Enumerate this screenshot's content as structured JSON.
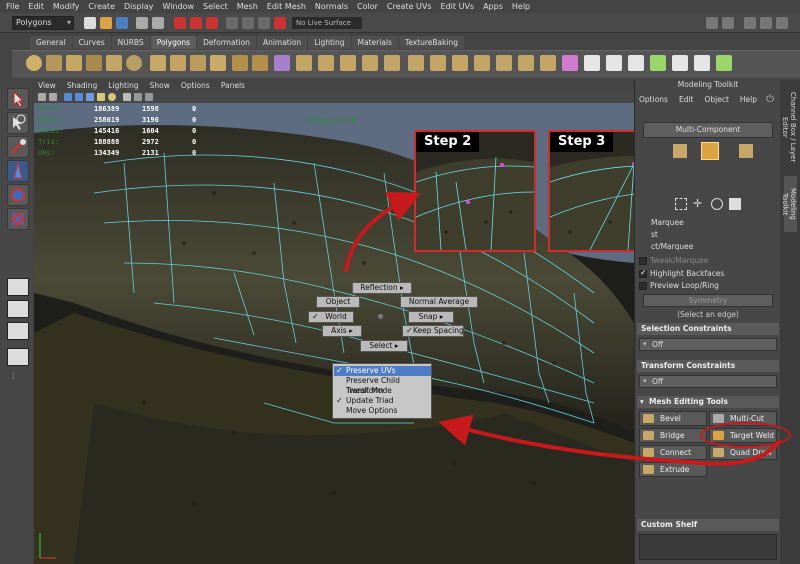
{
  "menubar": [
    "File",
    "Edit",
    "Modify",
    "Create",
    "Display",
    "Window",
    "Select",
    "Mesh",
    "Edit Mesh",
    "Normals",
    "Color",
    "Create UVs",
    "Edit UVs",
    "Apps",
    "Help"
  ],
  "status": {
    "mode": "Polygons",
    "live_surface": "No Live Surface"
  },
  "shelf_tabs": [
    {
      "label": "General",
      "active": false
    },
    {
      "label": "Curves",
      "active": false
    },
    {
      "label": "NURBS",
      "active": false
    },
    {
      "label": "Polygons",
      "active": true
    },
    {
      "label": "Deformation",
      "active": false
    },
    {
      "label": "Animation",
      "active": false
    },
    {
      "label": "Lighting",
      "active": false
    },
    {
      "label": "Materials",
      "active": false
    },
    {
      "label": "TextureBaking",
      "active": false
    }
  ],
  "viewport": {
    "menu": [
      "View",
      "Shading",
      "Lighting",
      "Show",
      "Options",
      "Panels"
    ],
    "hud": [
      {
        "label": "Verts:",
        "c1": "186389",
        "c2": "1598",
        "c3": "0"
      },
      {
        "label": "Edges:",
        "c1": "258019",
        "c2": "3196",
        "c3": "0"
      },
      {
        "label": "Faces:",
        "c1": "145416",
        "c2": "1604",
        "c3": "0"
      },
      {
        "label": "Tris:",
        "c1": "188888",
        "c2": "2972",
        "c3": "0"
      },
      {
        "label": "UVs:",
        "c1": "134349",
        "c2": "2131",
        "c3": "0"
      }
    ],
    "hud_title": "Viewport 2.0",
    "step2": "Step 2",
    "step3": "Step 3"
  },
  "marking_menu": {
    "reflection": "Reflection",
    "object": "Object",
    "normal_average": "Normal Average",
    "world": "World",
    "snap": "Snap",
    "axis": "Axis",
    "keep_spacing": "Keep Spacing",
    "select": "Select"
  },
  "options_menu": {
    "items": [
      {
        "label": "Preserve UVs",
        "checked": true,
        "active": true
      },
      {
        "label": "Preserve Child Transform",
        "checked": false,
        "active": false
      },
      {
        "label": "Tweak Mode",
        "checked": false,
        "active": false
      },
      {
        "label": "Update Triad",
        "checked": true,
        "active": false
      },
      {
        "label": "Move Options",
        "checked": false,
        "active": false
      }
    ]
  },
  "toolkit": {
    "title": "Modeling Toolkit",
    "menu": [
      "Options",
      "Edit",
      "Object",
      "Help"
    ],
    "multi_component": "Multi-Component",
    "selection_rows": [
      {
        "label": "Marquee",
        "checked": false
      },
      {
        "label": "st",
        "checked": false
      },
      {
        "label": "ct/Marquee",
        "checked": false
      },
      {
        "label": "Tweak/Marquee",
        "checked": false
      },
      {
        "label": "Highlight Backfaces",
        "checked": true
      },
      {
        "label": "Preview Loop/Ring",
        "checked": false
      }
    ],
    "symmetry": "Symmetry",
    "select_edge_hint": "(Select an edge)",
    "selection_constraints": "Selection Constraints",
    "sc_value": "Off",
    "transform_constraints": "Transform Constraints",
    "tc_value": "Off",
    "mesh_editing_tools": "Mesh Editing Tools",
    "tools": [
      "Bevel",
      "Multi-Cut",
      "Bridge",
      "Target Weld",
      "Connect",
      "Quad Draw",
      "Extrude"
    ],
    "custom_shelf": "Custom Shelf"
  },
  "right_tabs": [
    "Channel Box / Layer Editor",
    "Modeling Toolkit"
  ],
  "colors": {
    "annotation": "#c8191d",
    "wire": "#6ae0f0",
    "mesh": "#3e3c2a"
  }
}
